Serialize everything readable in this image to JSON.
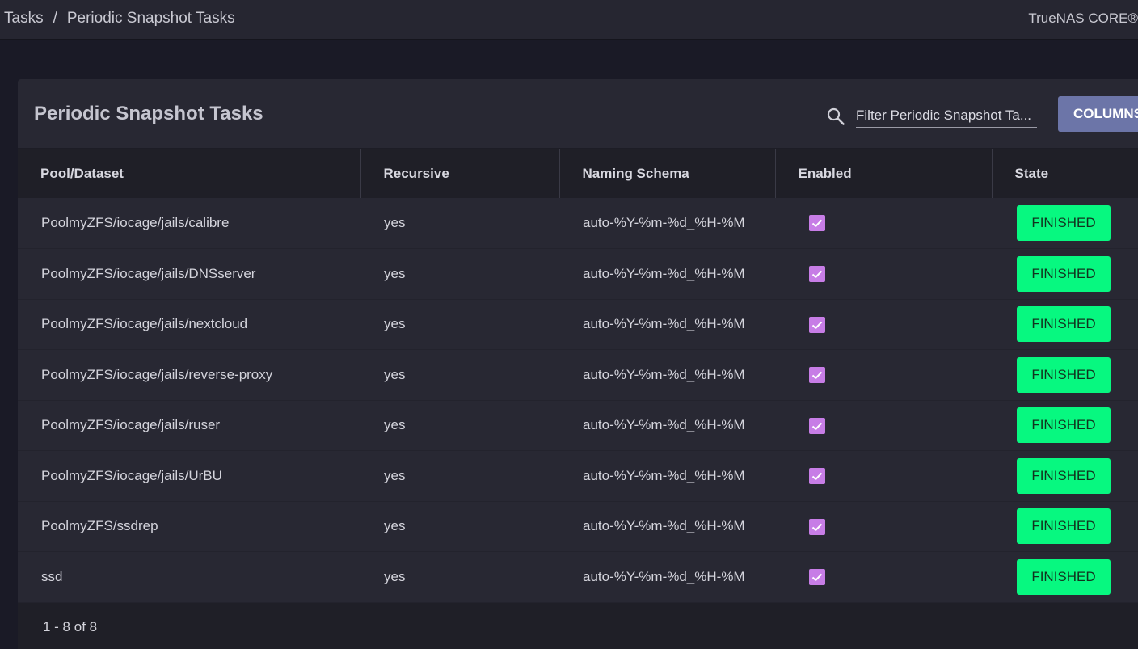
{
  "breadcrumb": {
    "items": [
      "Tasks",
      "Periodic Snapshot Tasks"
    ],
    "separator": "/"
  },
  "brand": "TrueNAS CORE®",
  "card": {
    "title": "Periodic Snapshot Tasks",
    "search_placeholder": "Filter Periodic Snapshot Ta...",
    "columns_button": "COLUMNS"
  },
  "table": {
    "columns": [
      "Pool/Dataset",
      "Recursive",
      "Naming Schema",
      "Enabled",
      "State"
    ],
    "rows": [
      {
        "dataset": "PoolmyZFS/iocage/jails/calibre",
        "recursive": "yes",
        "schema": "auto-%Y-%m-%d_%H-%M",
        "enabled": true,
        "state": "FINISHED"
      },
      {
        "dataset": "PoolmyZFS/iocage/jails/DNSserver",
        "recursive": "yes",
        "schema": "auto-%Y-%m-%d_%H-%M",
        "enabled": true,
        "state": "FINISHED"
      },
      {
        "dataset": "PoolmyZFS/iocage/jails/nextcloud",
        "recursive": "yes",
        "schema": "auto-%Y-%m-%d_%H-%M",
        "enabled": true,
        "state": "FINISHED"
      },
      {
        "dataset": "PoolmyZFS/iocage/jails/reverse-proxy",
        "recursive": "yes",
        "schema": "auto-%Y-%m-%d_%H-%M",
        "enabled": true,
        "state": "FINISHED"
      },
      {
        "dataset": "PoolmyZFS/iocage/jails/ruser",
        "recursive": "yes",
        "schema": "auto-%Y-%m-%d_%H-%M",
        "enabled": true,
        "state": "FINISHED"
      },
      {
        "dataset": "PoolmyZFS/iocage/jails/UrBU",
        "recursive": "yes",
        "schema": "auto-%Y-%m-%d_%H-%M",
        "enabled": true,
        "state": "FINISHED"
      },
      {
        "dataset": "PoolmyZFS/ssdrep",
        "recursive": "yes",
        "schema": "auto-%Y-%m-%d_%H-%M",
        "enabled": true,
        "state": "FINISHED"
      },
      {
        "dataset": "ssd",
        "recursive": "yes",
        "schema": "auto-%Y-%m-%d_%H-%M",
        "enabled": true,
        "state": "FINISHED"
      }
    ]
  },
  "pager": "1 - 8 of 8",
  "icons": {
    "search": "search-icon",
    "checkbox": "checkbox-checked-icon"
  },
  "colors": {
    "accent": "#6c75a8",
    "checkbox": "#c77de6",
    "state_finished": "#07f880"
  }
}
